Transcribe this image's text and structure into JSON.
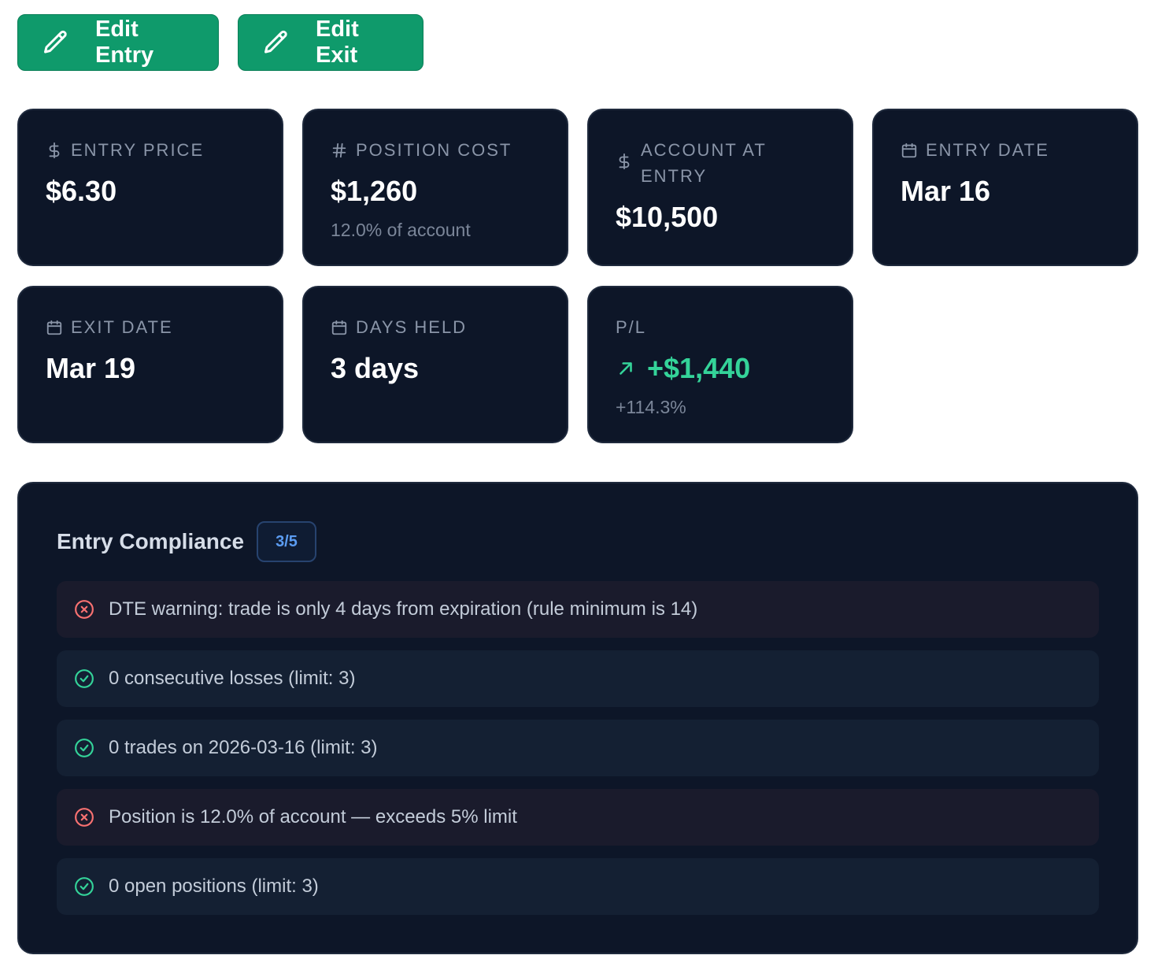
{
  "actions": {
    "edit_entry": "Edit Entry",
    "edit_exit": "Edit Exit"
  },
  "stats": {
    "entry_price": {
      "label": "Entry Price",
      "value": "$6.30"
    },
    "position_cost": {
      "label": "Position Cost",
      "value": "$1,260",
      "sub": "12.0% of account"
    },
    "account_at_entry": {
      "label": "Account at Entry",
      "value": "$10,500"
    },
    "entry_date": {
      "label": "Entry Date",
      "value": "Mar 16"
    },
    "exit_date": {
      "label": "Exit Date",
      "value": "Mar 19"
    },
    "days_held": {
      "label": "Days Held",
      "value": "3 days"
    },
    "pl": {
      "label": "P/L",
      "value": "+$1,440",
      "sub": "+114.3%"
    }
  },
  "compliance": {
    "title": "Entry Compliance",
    "score": "3/5",
    "items": [
      {
        "status": "fail",
        "text": "DTE warning: trade is only 4 days from expiration (rule minimum is 14)"
      },
      {
        "status": "pass",
        "text": "0 consecutive losses (limit: 3)"
      },
      {
        "status": "pass",
        "text": "0 trades on 2026-03-16 (limit: 3)"
      },
      {
        "status": "fail",
        "text": "Position is 12.0% of account — exceeds 5% limit"
      },
      {
        "status": "pass",
        "text": "0 open positions (limit: 3)"
      }
    ]
  },
  "colors": {
    "button": "#0f9a6b",
    "card": "#0d1628",
    "pass": "#34d399",
    "fail": "#f87171",
    "badge": "#5b9cf2"
  },
  "icons": {
    "edit": "pencil-icon",
    "currency": "dollar-icon",
    "count": "hash-icon",
    "date": "calendar-icon",
    "trend": "arrow-up-right-icon",
    "pass": "check-circle-icon",
    "fail": "x-circle-icon"
  }
}
